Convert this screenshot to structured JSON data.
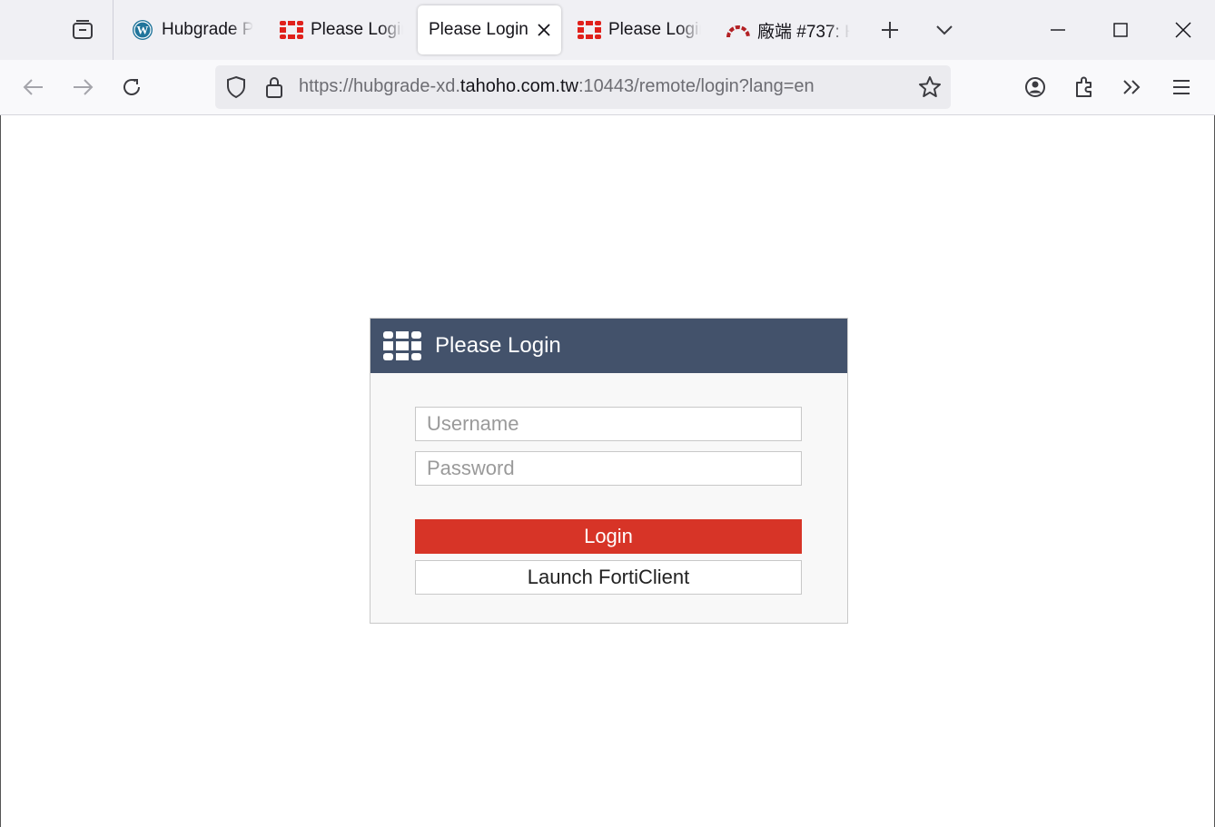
{
  "browser": {
    "tabs": [
      {
        "title": "Hubgrade P",
        "icon": "wordpress-icon"
      },
      {
        "title": "Please Login",
        "icon": "fortinet-icon"
      },
      {
        "title": "Please Login",
        "icon": "",
        "active": true
      },
      {
        "title": "Please Login",
        "icon": "fortinet-icon"
      },
      {
        "title": "廠端 #737: H",
        "icon": "redmine-icon"
      }
    ],
    "url": {
      "prefix": "https://hubgrade-xd.",
      "domain": "tahoho.com.tw",
      "suffix": ":10443/remote/login?lang=en"
    }
  },
  "login": {
    "title": "Please Login",
    "username_placeholder": "Username",
    "password_placeholder": "Password",
    "login_label": "Login",
    "forticlient_label": "Launch FortiClient"
  },
  "colors": {
    "header_bg": "#43526b",
    "login_button": "#d73427",
    "fortinet_red": "#e0201b"
  }
}
